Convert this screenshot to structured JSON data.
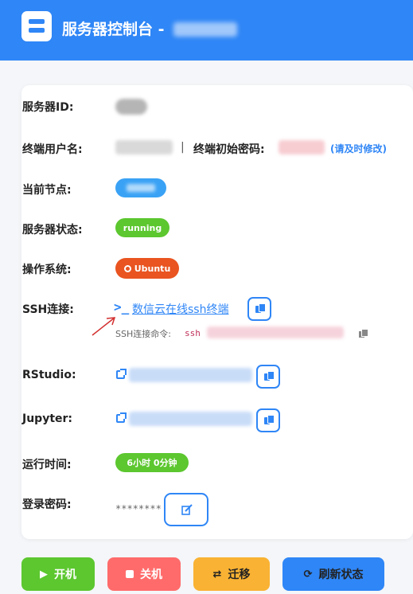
{
  "header": {
    "title": "服务器控制台 -",
    "icon": "server-icon"
  },
  "fields": {
    "server_id_label": "服务器ID:",
    "terminal_user_label": "终端用户名:",
    "separator": "|",
    "init_password_label": "终端初始密码:",
    "password_hint": "(请及时修改)",
    "current_node_label": "当前节点:",
    "server_status_label": "服务器状态:",
    "server_status_value": "running",
    "os_label": "操作系统:",
    "os_value": "Ubuntu",
    "ssh_label": "SSH连接:",
    "ssh_link": "数信云在线ssh终端",
    "ssh_cmd_label": "SSH连接命令:",
    "ssh_cmd_prefix": "ssh",
    "rstudio_label": "RStudio:",
    "jupyter_label": "Jupyter:",
    "uptime_label": "运行时间:",
    "uptime_value": "6小时 0分钟",
    "login_password_label": "登录密码:",
    "login_password_value": "********"
  },
  "buttons": {
    "start": "开机",
    "shutdown": "关机",
    "migrate": "迁移",
    "refresh": "刷新状态"
  },
  "colors": {
    "primary": "#2f86f6",
    "running": "#5cc72f",
    "ubuntu": "#e95420",
    "start": "#5cc72f",
    "shutdown": "#ff6b6b",
    "migrate": "#f9b233",
    "refresh": "#2f86f6"
  }
}
